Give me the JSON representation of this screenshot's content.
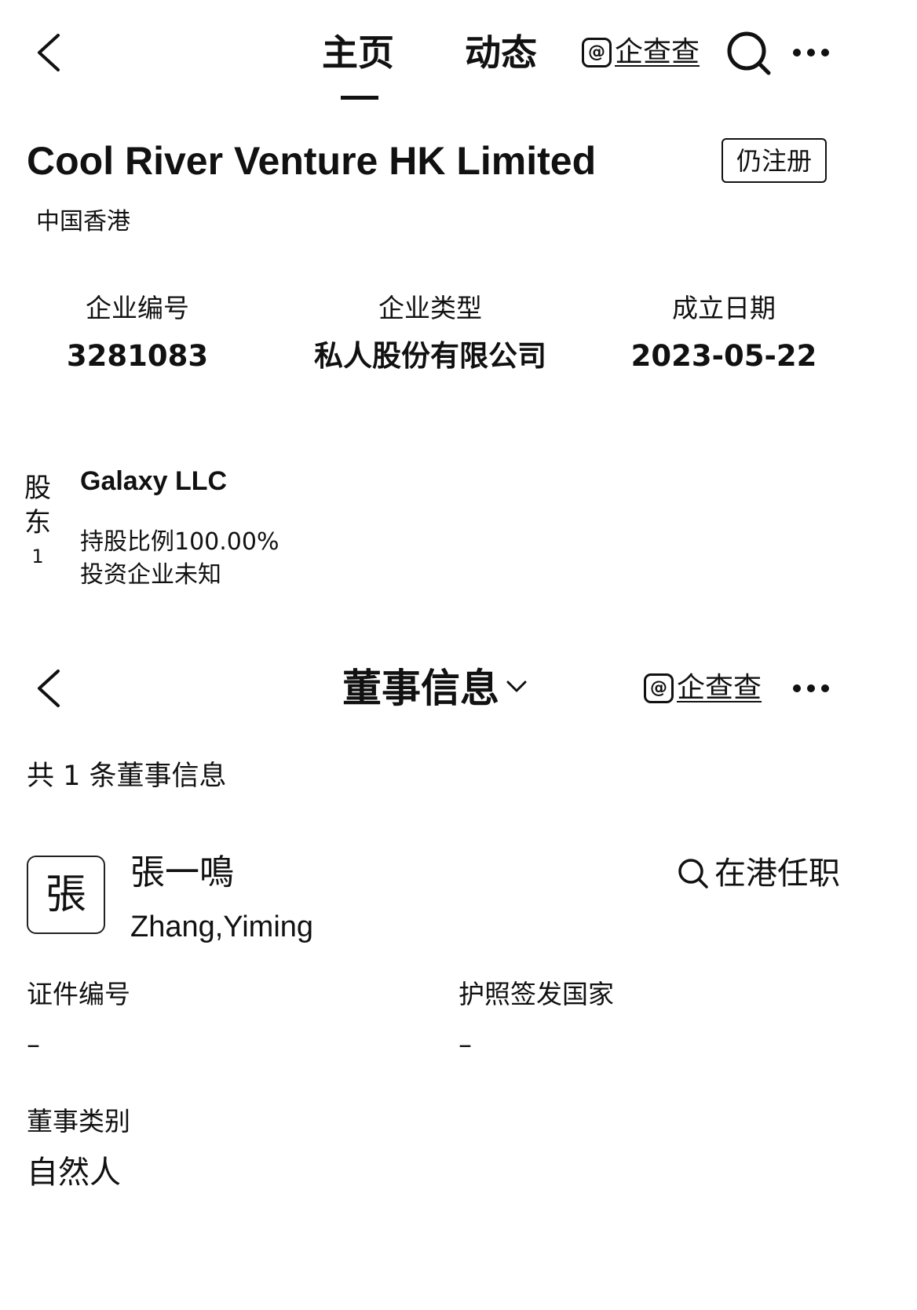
{
  "top_nav": {
    "tabs": [
      {
        "label": "主页",
        "active": true
      },
      {
        "label": "动态",
        "active": false
      }
    ],
    "brand": {
      "logo_glyph": "@",
      "name": "企查查"
    },
    "icons": {
      "back": "chevron-left-icon",
      "search": "search-icon",
      "more": "more-icon"
    }
  },
  "company": {
    "name": "Cool River Venture HK Limited",
    "status": "仍注册",
    "region": "中国香港",
    "stats": [
      {
        "label": "企业编号",
        "value": "3281083"
      },
      {
        "label": "企业类型",
        "value": "私人股份有限公司"
      },
      {
        "label": "成立日期",
        "value": "2023-05-22"
      }
    ]
  },
  "shareholder": {
    "label_chars": [
      "股",
      "东"
    ],
    "index": "1",
    "name": "Galaxy LLC",
    "ratio": "持股比例100.00%",
    "investment": "投资企业未知"
  },
  "directors_page": {
    "title": "董事信息",
    "brand": {
      "logo_glyph": "@",
      "name": "企查查"
    },
    "total": "共 1 条董事信息",
    "director": {
      "avatar_glyph": "張",
      "name": "張一鳴",
      "pinyin": "Zhang,Yiming",
      "hk_link": "在港任职",
      "fields": {
        "id_number": {
          "label": "证件编号",
          "value": "–"
        },
        "passport_country": {
          "label": "护照签发国家",
          "value": "–"
        },
        "director_type": {
          "label": "董事类别",
          "value": "自然人"
        }
      }
    }
  }
}
